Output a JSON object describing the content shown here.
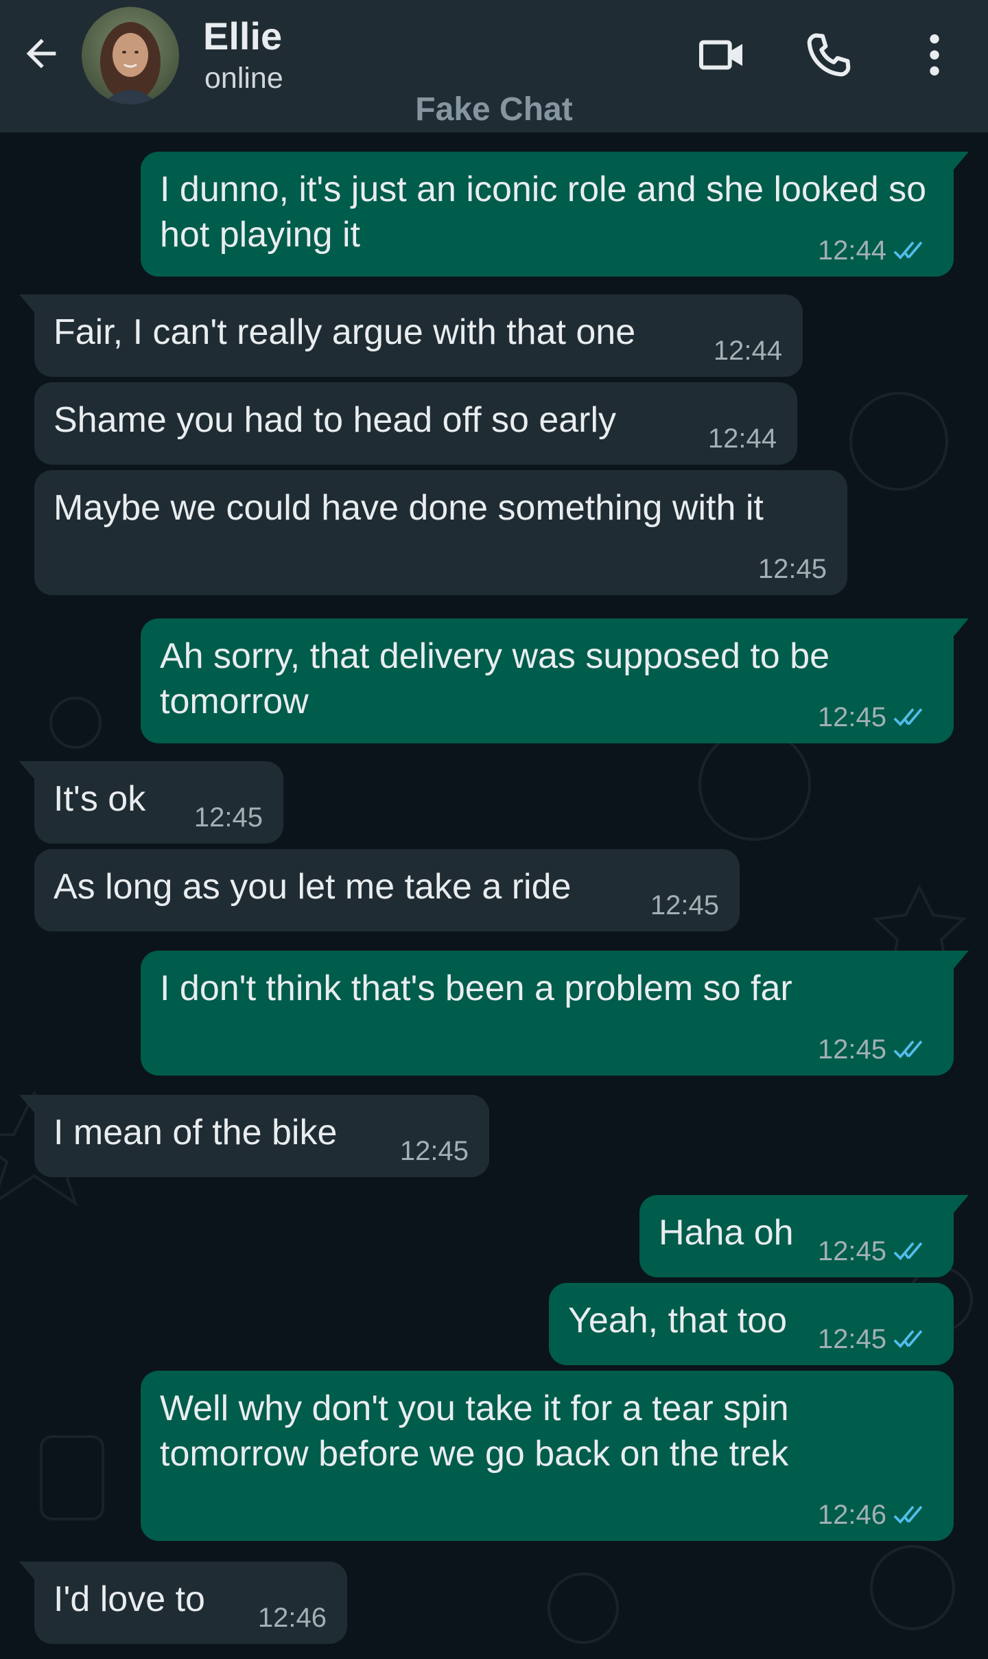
{
  "header": {
    "contact_name": "Ellie",
    "contact_status": "online",
    "watermark": "Fake Chat",
    "icons": [
      "back-arrow-icon",
      "video-call-icon",
      "voice-call-icon",
      "more-options-icon"
    ]
  },
  "colors": {
    "header_bg": "#202c33",
    "chat_bg": "#0b141a",
    "incoming_bubble": "#202c33",
    "outgoing_bubble": "#005c4b",
    "read_tick": "#53bdeb"
  },
  "messages": [
    {
      "dir": "out",
      "text": "I dunno, it's just an iconic role and she looked so hot playing it",
      "time": "12:44",
      "status": "read"
    },
    {
      "dir": "in",
      "text": "Fair, I can't really argue with that one",
      "time": "12:44"
    },
    {
      "dir": "in",
      "text": "Shame you had to head off so early",
      "time": "12:44"
    },
    {
      "dir": "in",
      "text": "Maybe we could have done something with it",
      "time": "12:45"
    },
    {
      "dir": "out",
      "text": "Ah sorry, that delivery was supposed to be tomorrow",
      "time": "12:45",
      "status": "read"
    },
    {
      "dir": "in",
      "text": "It's ok",
      "time": "12:45"
    },
    {
      "dir": "in",
      "text": "As long as you let me take a ride",
      "time": "12:45"
    },
    {
      "dir": "out",
      "text": "I don't think that's been a problem so far",
      "time": "12:45",
      "status": "read"
    },
    {
      "dir": "in",
      "text": "I mean of the bike",
      "time": "12:45"
    },
    {
      "dir": "out",
      "text": "Haha oh",
      "time": "12:45",
      "status": "read"
    },
    {
      "dir": "out",
      "text": "Yeah, that too",
      "time": "12:45",
      "status": "read"
    },
    {
      "dir": "out",
      "text": "Well why don't you take it for a tear spin tomorrow before we go back on the trek",
      "time": "12:46",
      "status": "read"
    },
    {
      "dir": "in",
      "text": "I'd love to",
      "time": "12:46"
    }
  ]
}
